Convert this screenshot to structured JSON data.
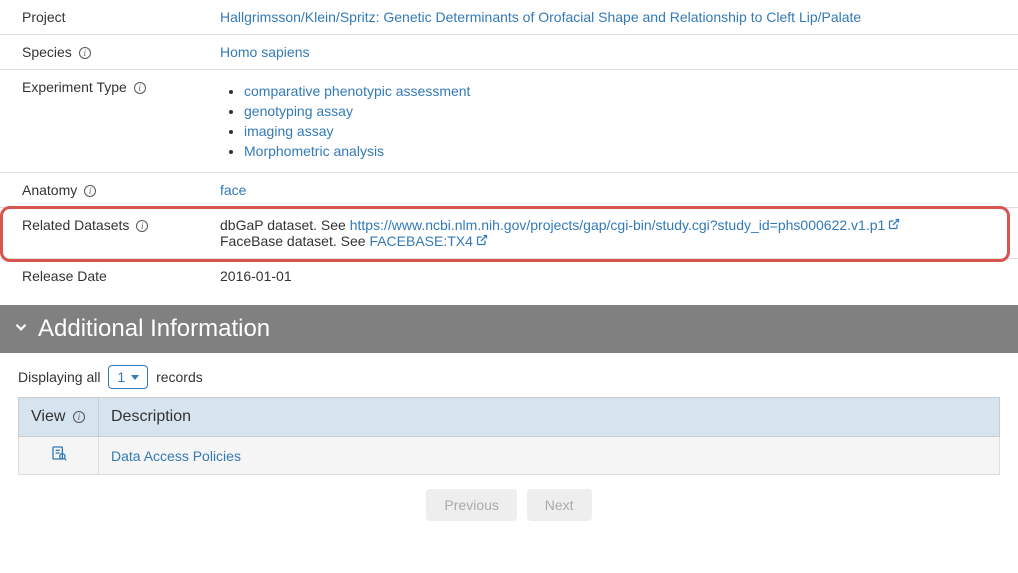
{
  "details": {
    "project": {
      "label": "Project",
      "value": "Hallgrimsson/Klein/Spritz: Genetic Determinants of Orofacial Shape and Relationship to Cleft Lip/Palate"
    },
    "species": {
      "label": "Species",
      "value": "Homo sapiens"
    },
    "experiment_type": {
      "label": "Experiment Type",
      "items": [
        "comparative phenotypic assessment",
        "genotyping assay",
        "imaging assay",
        "Morphometric analysis"
      ]
    },
    "anatomy": {
      "label": "Anatomy",
      "value": "face"
    },
    "related": {
      "label": "Related Datasets",
      "line1_prefix": "dbGaP dataset. See ",
      "line1_link": "https://www.ncbi.nlm.nih.gov/projects/gap/cgi-bin/study.cgi?study_id=phs000622.v1.p1",
      "line2_prefix": "FaceBase dataset. See ",
      "line2_link": "FACEBASE:TX4"
    },
    "release": {
      "label": "Release Date",
      "value": "2016-01-01"
    }
  },
  "section": {
    "title": "Additional Information"
  },
  "records": {
    "prefix": "Displaying all",
    "count": "1",
    "suffix": "records"
  },
  "table": {
    "col_view": "View",
    "col_desc": "Description",
    "rows": [
      {
        "desc": "Data Access Policies"
      }
    ]
  },
  "pager": {
    "prev": "Previous",
    "next": "Next"
  }
}
